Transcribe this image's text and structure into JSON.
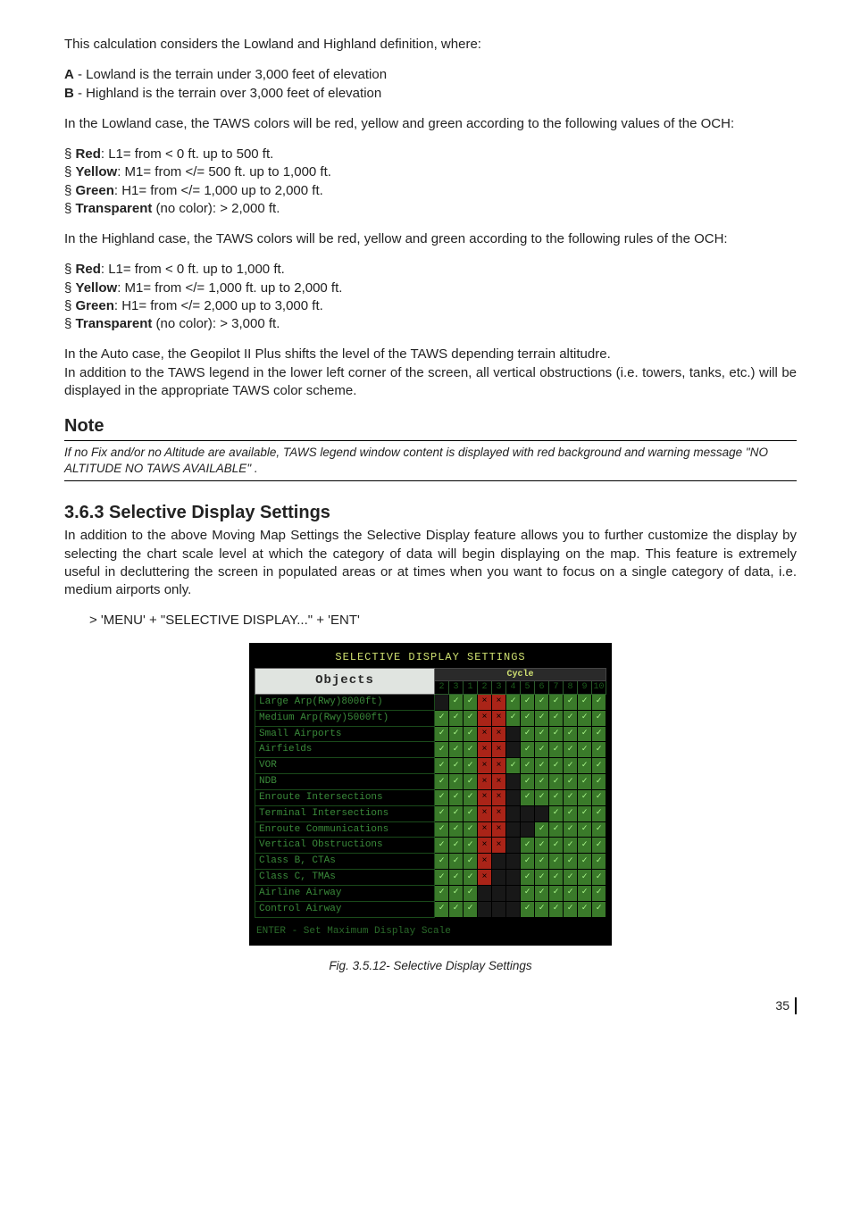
{
  "p1": "This calculation considers the Lowland and Highland definition, where:",
  "defA": "A",
  "defA_txt": " - Lowland is the terrain under 3,000 feet of elevation",
  "defB": "B",
  "defB_txt": " - Highland is the terrain over 3,000 feet of elevation",
  "p2": "In the Lowland case, the TAWS colors will be red, yellow and green according to the following values of the OCH:",
  "l1_prefix": "§ ",
  "l1a_b": "Red",
  "l1a_t": ": L1= from < 0 ft. up to 500 ft.",
  "l1b_b": "Yellow",
  "l1b_t": ": M1= from </= 500 ft. up to 1,000 ft.",
  "l1c_b": "Green",
  "l1c_t": ": H1= from </= 1,000 up to 2,000 ft.",
  "l1d_b": "Transparent",
  "l1d_t": " (no color): > 2,000 ft.",
  "p3": "In the Highland case, the TAWS colors will be red, yellow and green according to the following rules of the OCH:",
  "l2a_b": "Red",
  "l2a_t": ": L1= from < 0 ft. up to 1,000 ft.",
  "l2b_b": "Yellow",
  "l2b_t": ": M1= from </= 1,000 ft. up to 2,000 ft.",
  "l2c_b": "Green",
  "l2c_t": ": H1= from </= 2,000 up to 3,000 ft.",
  "l2d_b": "Transparent",
  "l2d_t": " (no color): > 3,000 ft.",
  "p4a": "In the Auto case, the Geopilot II Plus shifts the level of the TAWS depending terrain altitudre.",
  "p4b": "In addition to the TAWS legend in the lower left corner of the screen, all vertical obstructions (i.e. towers, tanks, etc.) will be displayed in the appropriate TAWS color scheme.",
  "note_h": "Note",
  "note_body": "If no Fix and/or no Altitude are available, TAWS legend window content is displayed with red background and warning message \"NO ALTITUDE NO TAWS AVAILABLE\" .",
  "sec_h": "3.6.3  Selective Display Settings",
  "sec_p": "In addition to the above Moving Map Settings the Selective Display feature allows you to further customize the display by selecting the chart scale level at which the category of data will begin displaying on the map. This feature is extremely useful in decluttering the screen in populated areas or at times when you want to focus on a single category of data, i.e. medium airports only.",
  "menu_line": "> 'MENU' + \"SELECTIVE DISPLAY...\" + 'ENT'",
  "ss_title": "SELECTIVE DISPLAY SETTINGS",
  "ss_objects": "Objects",
  "ss_cycle": "Cycle",
  "ss_nums": [
    "2",
    "3",
    "1",
    "2",
    "3",
    "4",
    "5",
    "6",
    "7",
    "8",
    "9",
    "10"
  ],
  "ss_rows": [
    "Large Arp(Rwy)8000ft)",
    "Medium Arp(Rwy)5000ft)",
    "Small Airports",
    "Airfields",
    "VOR",
    "NDB",
    "Enroute Intersections",
    "Terminal Intersections",
    "Enroute Communications",
    "Vertical Obstructions",
    "Class B, CTAs",
    "Class C, TMAs",
    "Airline Airway",
    "Control Airway"
  ],
  "ss_footer": "ENTER - Set Maximum Display Scale",
  "caption": "Fig. 3.5.12- Selective Display Settings",
  "page_no": "35",
  "grid": [
    [
      "d",
      "g",
      "g",
      "r",
      "r",
      "g",
      "g",
      "g",
      "g",
      "g",
      "g",
      "g"
    ],
    [
      "g",
      "g",
      "g",
      "r",
      "r",
      "g",
      "g",
      "g",
      "g",
      "g",
      "g",
      "g"
    ],
    [
      "g",
      "g",
      "g",
      "r",
      "r",
      "d",
      "g",
      "g",
      "g",
      "g",
      "g",
      "g"
    ],
    [
      "g",
      "g",
      "g",
      "r",
      "r",
      "d",
      "g",
      "g",
      "g",
      "g",
      "g",
      "g"
    ],
    [
      "g",
      "g",
      "g",
      "r",
      "r",
      "g",
      "g",
      "g",
      "g",
      "g",
      "g",
      "g"
    ],
    [
      "g",
      "g",
      "g",
      "r",
      "r",
      "d",
      "g",
      "g",
      "g",
      "g",
      "g",
      "g"
    ],
    [
      "g",
      "g",
      "g",
      "r",
      "r",
      "d",
      "g",
      "g",
      "g",
      "g",
      "g",
      "g"
    ],
    [
      "g",
      "g",
      "g",
      "r",
      "r",
      "d",
      "d",
      "d",
      "g",
      "g",
      "g",
      "g"
    ],
    [
      "g",
      "g",
      "g",
      "r",
      "r",
      "d",
      "d",
      "g",
      "g",
      "g",
      "g",
      "g"
    ],
    [
      "g",
      "g",
      "g",
      "r",
      "r",
      "d",
      "g",
      "g",
      "g",
      "g",
      "g",
      "g"
    ],
    [
      "g",
      "g",
      "g",
      "r",
      "d",
      "d",
      "g",
      "g",
      "g",
      "g",
      "g",
      "g"
    ],
    [
      "g",
      "g",
      "g",
      "r",
      "d",
      "d",
      "g",
      "g",
      "g",
      "g",
      "g",
      "g"
    ],
    [
      "g",
      "g",
      "g",
      "d",
      "d",
      "d",
      "g",
      "g",
      "g",
      "g",
      "g",
      "g"
    ],
    [
      "g",
      "g",
      "g",
      "d",
      "d",
      "d",
      "g",
      "g",
      "g",
      "g",
      "g",
      "g"
    ]
  ]
}
